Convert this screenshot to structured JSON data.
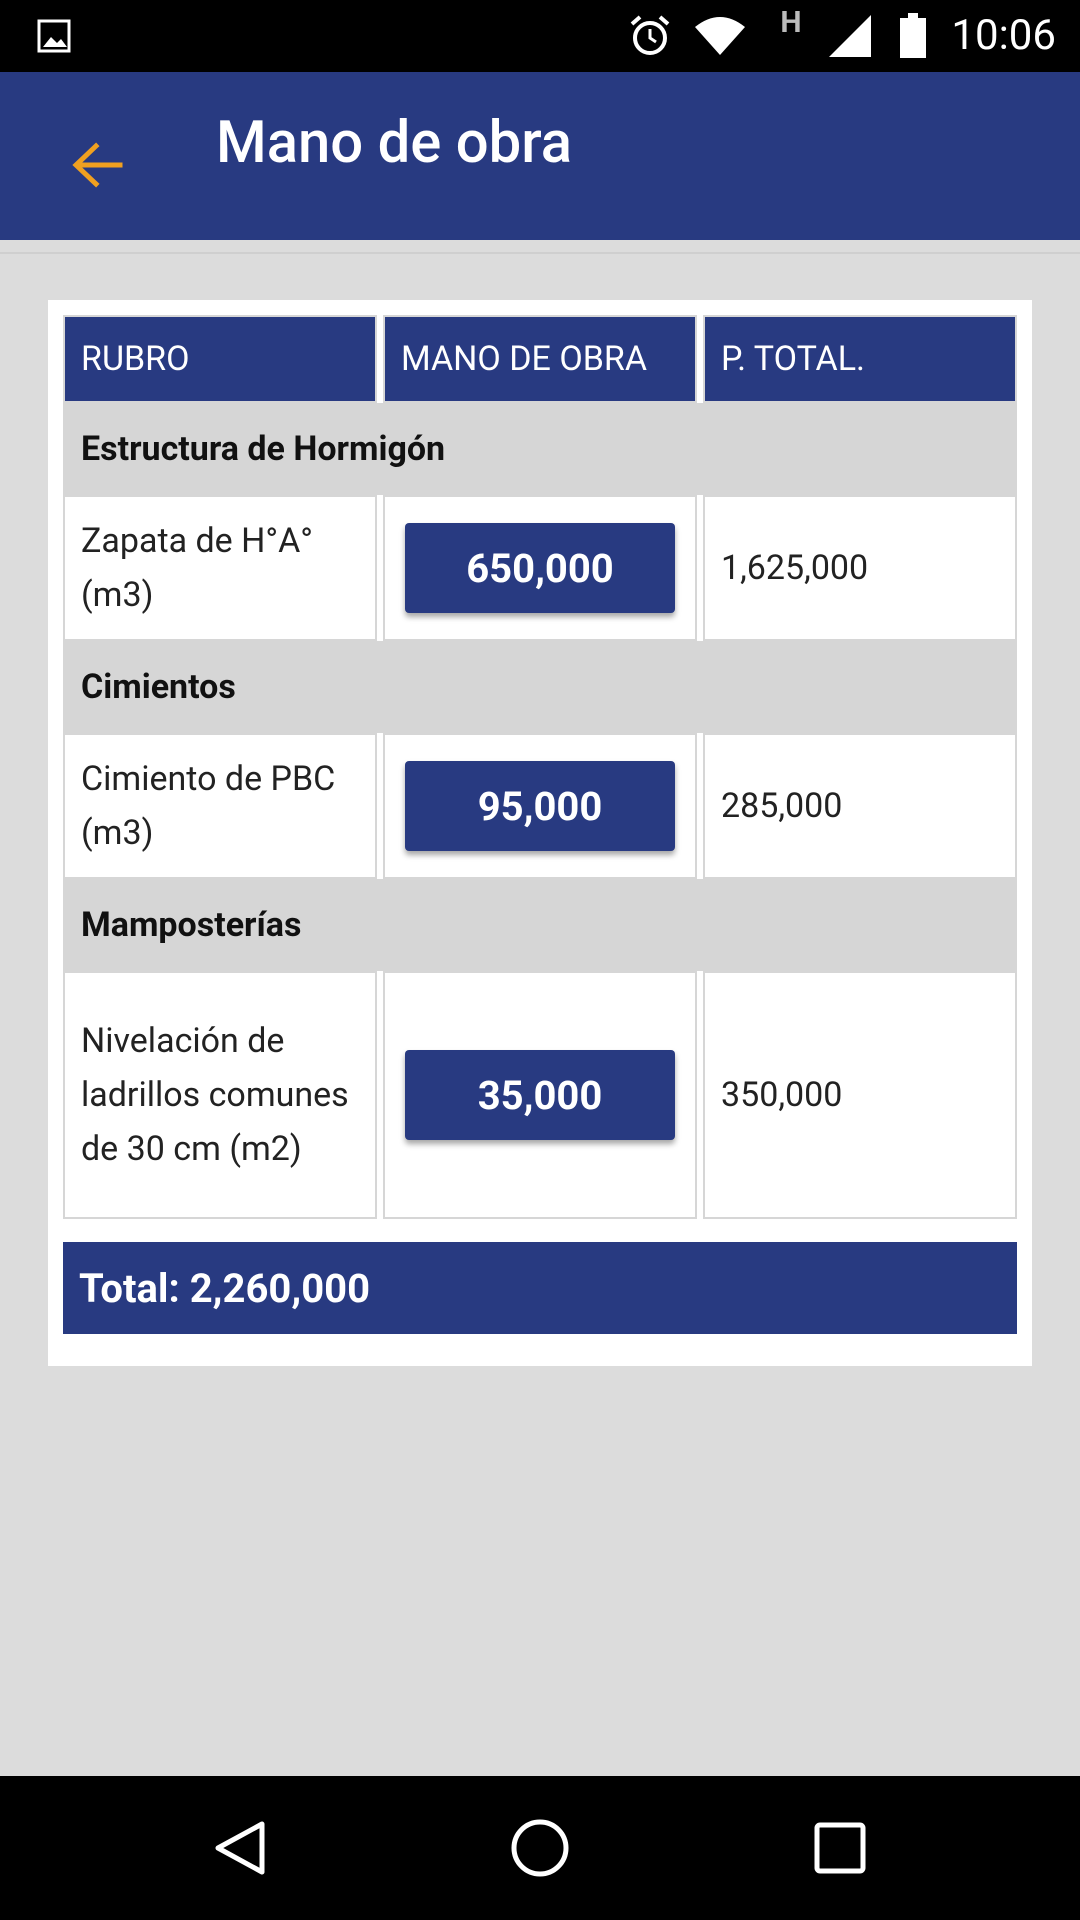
{
  "status_bar": {
    "time": "10:06",
    "network_label": "H",
    "icons": [
      "image-icon",
      "alarm-icon",
      "wifi-icon",
      "signal-icon",
      "battery-icon"
    ]
  },
  "app_bar": {
    "title": "Mano de obra",
    "back_icon": "arrow-left-icon",
    "back_icon_color": "#f0a020"
  },
  "colors": {
    "primary": "#283a81",
    "accent": "#f0a020",
    "section_bg": "#d6d6d6"
  },
  "table": {
    "headers": [
      "RUBRO",
      "MANO DE OBRA",
      "P. TOTAL."
    ],
    "sections": [
      {
        "title": "Estructura de Hormigón",
        "rows": [
          {
            "rubro": "Zapata de H°A° (m3)",
            "mano_de_obra": "650,000",
            "p_total": "1,625,000"
          }
        ]
      },
      {
        "title": "Cimientos",
        "rows": [
          {
            "rubro": "Cimiento de PBC (m3)",
            "mano_de_obra": "95,000",
            "p_total": "285,000"
          }
        ]
      },
      {
        "title": "Mamposterías",
        "rows": [
          {
            "rubro": "Nivelación de ladrillos comunes de 30 cm (m2)",
            "mano_de_obra": "35,000",
            "p_total": "350,000"
          }
        ]
      }
    ]
  },
  "total_label": "Total: 2,260,000",
  "nav_bar": {
    "icons": [
      "back-triangle-icon",
      "home-circle-icon",
      "recents-square-icon"
    ]
  }
}
